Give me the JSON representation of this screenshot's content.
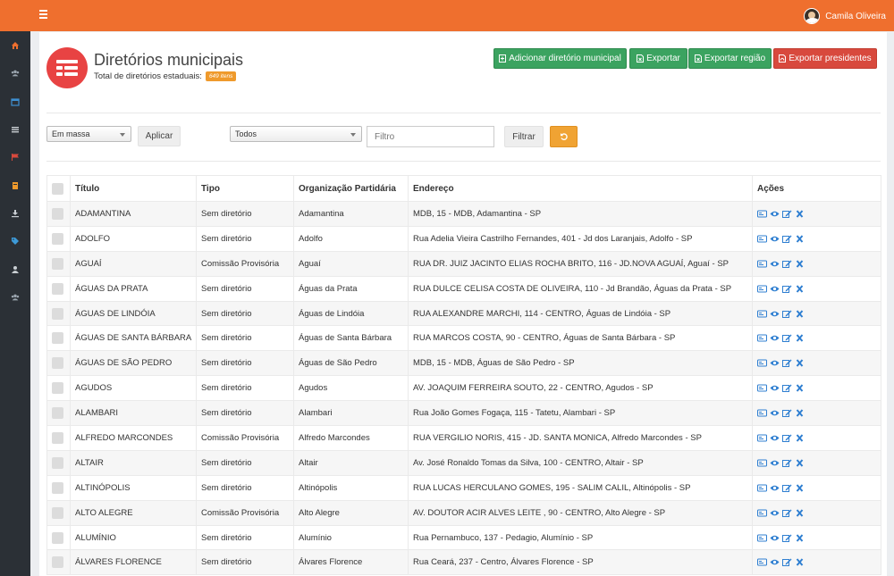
{
  "app": {
    "user_name": "Camila Oliveira"
  },
  "sidebar": {
    "items": [
      "home-icon",
      "users-icon",
      "calendar-icon",
      "list-icon",
      "flag-icon",
      "book-icon",
      "download-icon",
      "tag-icon",
      "user-icon",
      "group-icon"
    ],
    "active_color": "#ef6f2e",
    "icon_color": "#8a8f95"
  },
  "header": {
    "title": "Diretórios municipais",
    "total_label": "Total de diretórios estaduais:",
    "total_badge": "649 itens",
    "buttons": {
      "add": "Adicionar diretório municipal",
      "export": "Exportar",
      "export_region": "Exportar região",
      "export_presidents": "Exportar presidentes"
    }
  },
  "filters": {
    "bulk_select": "Em massa",
    "apply_label": "Aplicar",
    "type_select": "Todos",
    "filter_placeholder": "Filtro",
    "filter_button": "Filtrar"
  },
  "table": {
    "headers": {
      "title": "Título",
      "type": "Tipo",
      "org": "Organização Partidária",
      "address": "Endereço",
      "actions": "Ações"
    },
    "rows": [
      {
        "title": "ADAMANTINA",
        "type": "Sem diretório",
        "org": "Adamantina",
        "address": "MDB, 15 - MDB, Adamantina - SP"
      },
      {
        "title": "ADOLFO",
        "type": "Sem diretório",
        "org": "Adolfo",
        "address": "Rua Adelia Vieira Castrilho Fernandes, 401 - Jd dos Laranjais, Adolfo - SP"
      },
      {
        "title": "AGUAÍ",
        "type": "Comissão Provisória",
        "org": "Aguaí",
        "address": "RUA DR. JUIZ JACINTO ELIAS ROCHA BRITO, 116 - JD.NOVA AGUAÍ, Aguaí - SP"
      },
      {
        "title": "ÁGUAS DA PRATA",
        "type": "Sem diretório",
        "org": "Águas da Prata",
        "address": "RUA DULCE CELISA COSTA DE OLIVEIRA, 110 - Jd Brandão, Águas da Prata - SP"
      },
      {
        "title": "ÁGUAS DE LINDÓIA",
        "type": "Sem diretório",
        "org": "Águas de Lindóia",
        "address": "RUA ALEXANDRE MARCHI, 114 - CENTRO, Águas de Lindóia - SP"
      },
      {
        "title": "ÁGUAS DE SANTA BÁRBARA",
        "type": "Sem diretório",
        "org": "Águas de Santa Bárbara",
        "address": "RUA MARCOS COSTA, 90 - CENTRO, Águas de Santa Bárbara - SP"
      },
      {
        "title": "ÁGUAS DE SÃO PEDRO",
        "type": "Sem diretório",
        "org": "Águas de São Pedro",
        "address": "MDB, 15 - MDB, Águas de São Pedro - SP"
      },
      {
        "title": "AGUDOS",
        "type": "Sem diretório",
        "org": "Agudos",
        "address": "AV. JOAQUIM FERREIRA SOUTO, 22 - CENTRO, Agudos - SP"
      },
      {
        "title": "ALAMBARI",
        "type": "Sem diretório",
        "org": "Alambari",
        "address": "Rua João Gomes Fogaça, 115 - Tatetu, Alambari - SP"
      },
      {
        "title": "ALFREDO MARCONDES",
        "type": "Comissão Provisória",
        "org": "Alfredo Marcondes",
        "address": "RUA VERGILIO NORIS, 415 - JD. SANTA MONICA, Alfredo Marcondes - SP"
      },
      {
        "title": "ALTAIR",
        "type": "Sem diretório",
        "org": "Altair",
        "address": "Av. José Ronaldo Tomas da Silva, 100 - CENTRO, Altair - SP"
      },
      {
        "title": "ALTINÓPOLIS",
        "type": "Sem diretório",
        "org": "Altinópolis",
        "address": "RUA LUCAS HERCULANO GOMES, 195 - SALIM CALIL, Altinópolis - SP"
      },
      {
        "title": "ALTO ALEGRE",
        "type": "Comissão Provisória",
        "org": "Alto Alegre",
        "address": "AV. DOUTOR ACIR ALVES LEITE , 90 - CENTRO, Alto Alegre - SP"
      },
      {
        "title": "ALUMÍNIO",
        "type": "Sem diretório",
        "org": "Alumínio",
        "address": "Rua Pernambuco, 137 - Pedagio, Alumínio - SP"
      },
      {
        "title": "ÁLVARES FLORENCE",
        "type": "Sem diretório",
        "org": "Álvares Florence",
        "address": "Rua Ceará, 237 - Centro, Álvares Florence - SP"
      }
    ]
  }
}
